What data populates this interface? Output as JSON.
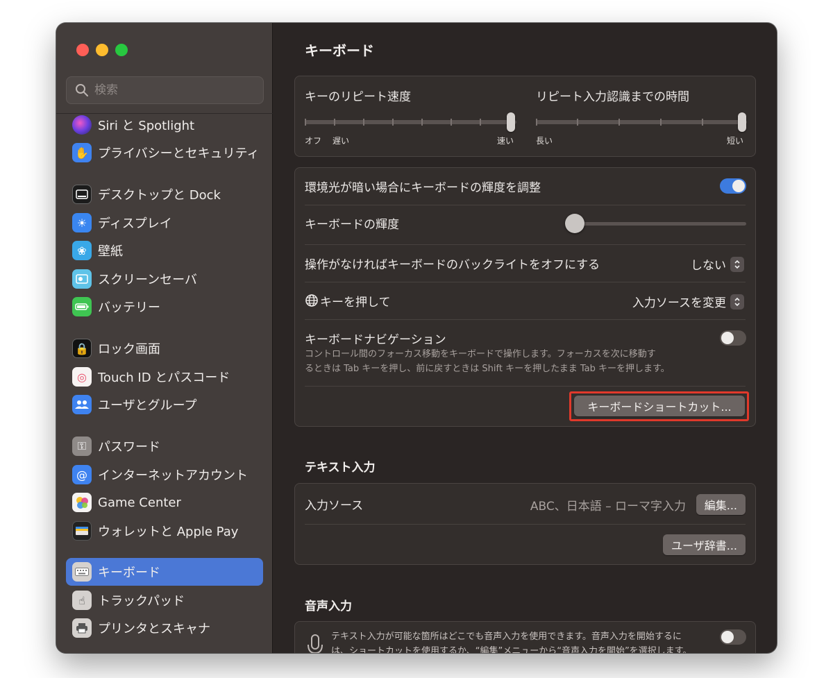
{
  "sidebar": {
    "search_placeholder": "検索",
    "items": [
      {
        "label": "Siri と Spotlight",
        "icon": "siri-icon"
      },
      {
        "label": "プライバシーとセキュリティ",
        "icon": "hand-icon"
      },
      {
        "label": "デスクトップと Dock",
        "icon": "dock-icon"
      },
      {
        "label": "ディスプレイ",
        "icon": "sun-icon"
      },
      {
        "label": "壁紙",
        "icon": "flower-icon"
      },
      {
        "label": "スクリーンセーバ",
        "icon": "screensaver-icon"
      },
      {
        "label": "バッテリー",
        "icon": "battery-icon"
      },
      {
        "label": "ロック画面",
        "icon": "lock-icon"
      },
      {
        "label": "Touch ID とパスコード",
        "icon": "fingerprint-icon"
      },
      {
        "label": "ユーザとグループ",
        "icon": "users-icon"
      },
      {
        "label": "パスワード",
        "icon": "key-icon"
      },
      {
        "label": "インターネットアカウント",
        "icon": "at-icon"
      },
      {
        "label": "Game Center",
        "icon": "game-center-icon"
      },
      {
        "label": "ウォレットと Apple Pay",
        "icon": "wallet-icon"
      },
      {
        "label": "キーボード",
        "icon": "keyboard-icon"
      },
      {
        "label": "トラックパッド",
        "icon": "trackpad-icon"
      },
      {
        "label": "プリンタとスキャナ",
        "icon": "printer-icon"
      }
    ],
    "selected": "キーボード"
  },
  "main": {
    "title": "キーボード",
    "repeat": {
      "rate_label": "キーのリピート速度",
      "rate_min1": "オフ",
      "rate_min2": "遅い",
      "rate_max": "速い",
      "rate_value": 1.0,
      "delay_label": "リピート入力認識までの時間",
      "delay_min": "長い",
      "delay_max": "短い",
      "delay_value": 1.0
    },
    "backlight": {
      "auto_label": "環境光が暗い場合にキーボードの輝度を調整",
      "auto_on": true,
      "brightness_label": "キーボードの輝度",
      "brightness_value": 0.0,
      "off_label": "操作がなければキーボードのバックライトをオフにする",
      "off_value": "しない",
      "globe_label": "キーを押して",
      "globe_value": "入力ソースを変更",
      "nav_label": "キーボードナビゲーション",
      "nav_desc_1": "コントロール間のフォーカス移動をキーボードで操作します。フォーカスを次に移動す",
      "nav_desc_2": "るときは Tab キーを押し、前に戻すときは Shift キーを押したまま Tab キーを押します。",
      "nav_on": false,
      "shortcuts_button": "キーボードショートカット..."
    },
    "text_input": {
      "section_title": "テキスト入力",
      "source_label": "入力ソース",
      "source_value": "ABC、日本語 – ローマ字入力",
      "edit_button": "編集...",
      "dict_button": "ユーザ辞書..."
    },
    "dictation": {
      "section_title": "音声入力",
      "desc_1": "テキスト入力が可能な箇所はどこでも音声入力を使用できます。音声入力を開始するに",
      "desc_2": "は、ショートカットを使用するか、“編集”メニューから“音声入力を開始”を選択します。",
      "on": false
    }
  },
  "colors": {
    "accent": "#4b78d6",
    "toggle_on": "#3d7bde",
    "highlight": "#e0392b"
  }
}
